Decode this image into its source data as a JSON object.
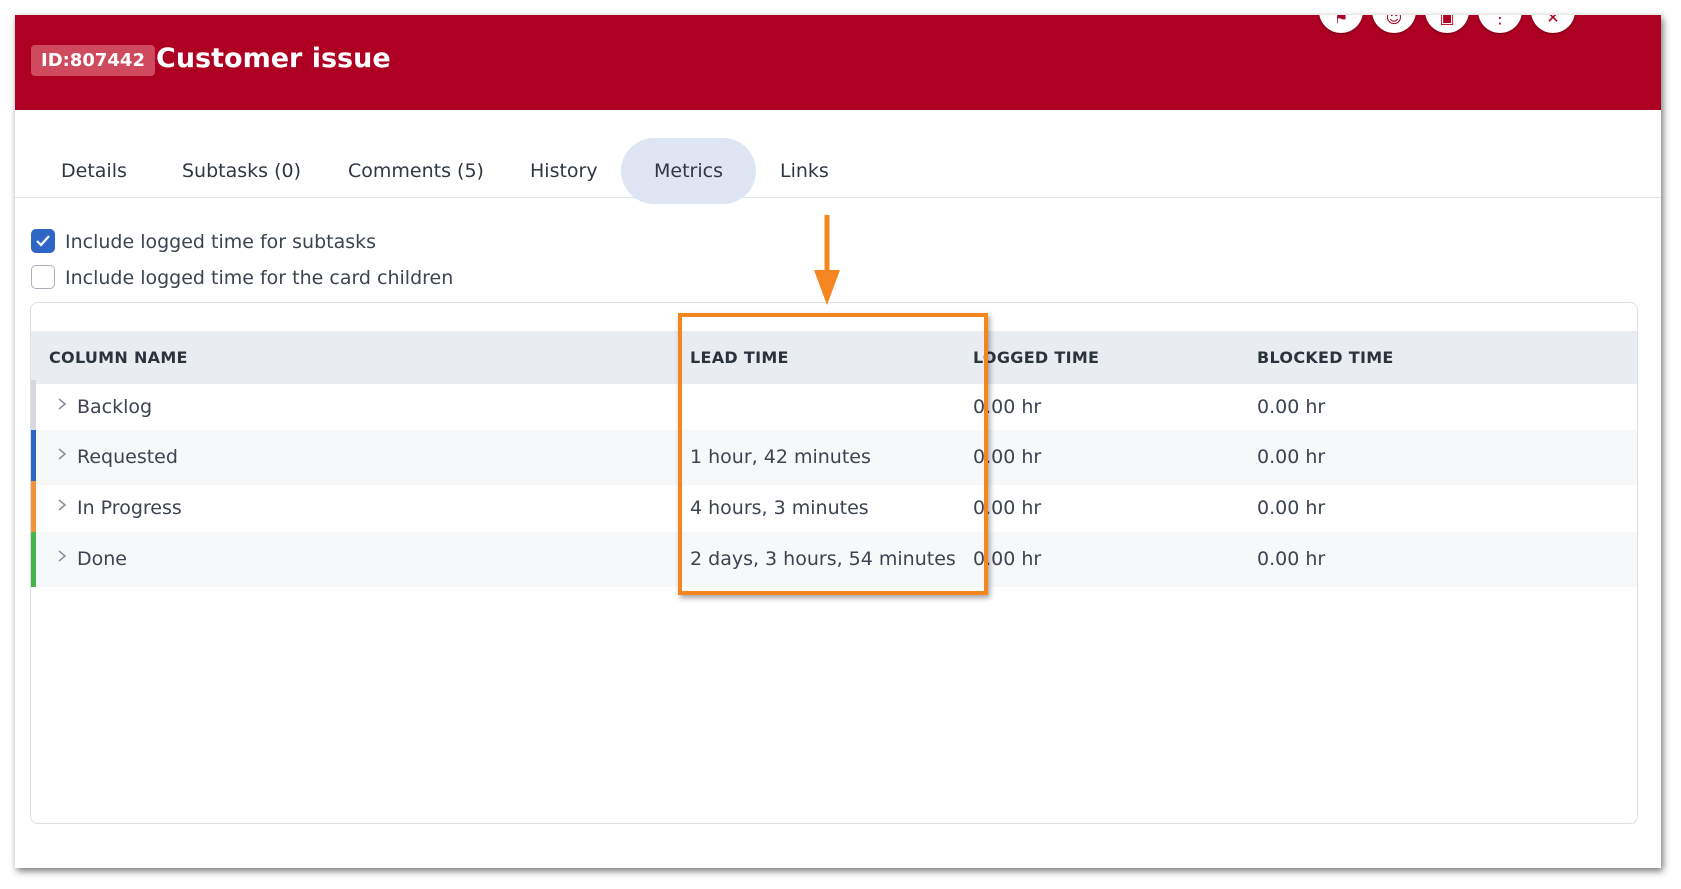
{
  "header": {
    "id_label": "ID:807442",
    "title": "Customer issue",
    "bg_color": "#ae0022"
  },
  "tabs": [
    {
      "label": "Details",
      "active": false
    },
    {
      "label": "Subtasks (0)",
      "active": false
    },
    {
      "label": "Comments (5)",
      "active": false
    },
    {
      "label": "History",
      "active": false
    },
    {
      "label": "Metrics",
      "active": true
    },
    {
      "label": "Links",
      "active": false
    }
  ],
  "options": [
    {
      "label": "Include logged time for subtasks",
      "checked": true
    },
    {
      "label": "Include logged time for the card children",
      "checked": false
    }
  ],
  "table": {
    "headers": [
      "COLUMN NAME",
      "LEAD TIME",
      "LOGGED TIME",
      "BLOCKED TIME"
    ],
    "rows": [
      {
        "name": "Backlog",
        "lead_time": "",
        "logged_time": "0.00 hr",
        "blocked_time": "0.00 hr",
        "color": "#d5d9de"
      },
      {
        "name": "Requested",
        "lead_time": "1 hour, 42 minutes",
        "logged_time": "0.00 hr",
        "blocked_time": "0.00 hr",
        "color": "#2d66c4"
      },
      {
        "name": "In Progress",
        "lead_time": "4 hours, 3 minutes",
        "logged_time": "0.00 hr",
        "blocked_time": "0.00 hr",
        "color": "#f0923a"
      },
      {
        "name": "Done",
        "lead_time": "2 days, 3 hours, 54 minutes",
        "logged_time": "0.00 hr",
        "blocked_time": "0.00 hr",
        "color": "#43b549"
      }
    ]
  },
  "annotation": {
    "highlight_color": "#f5851f",
    "target": "LEAD TIME"
  },
  "icons": {
    "row_expand": "chevron-right-icon",
    "checkbox": "check-icon"
  }
}
